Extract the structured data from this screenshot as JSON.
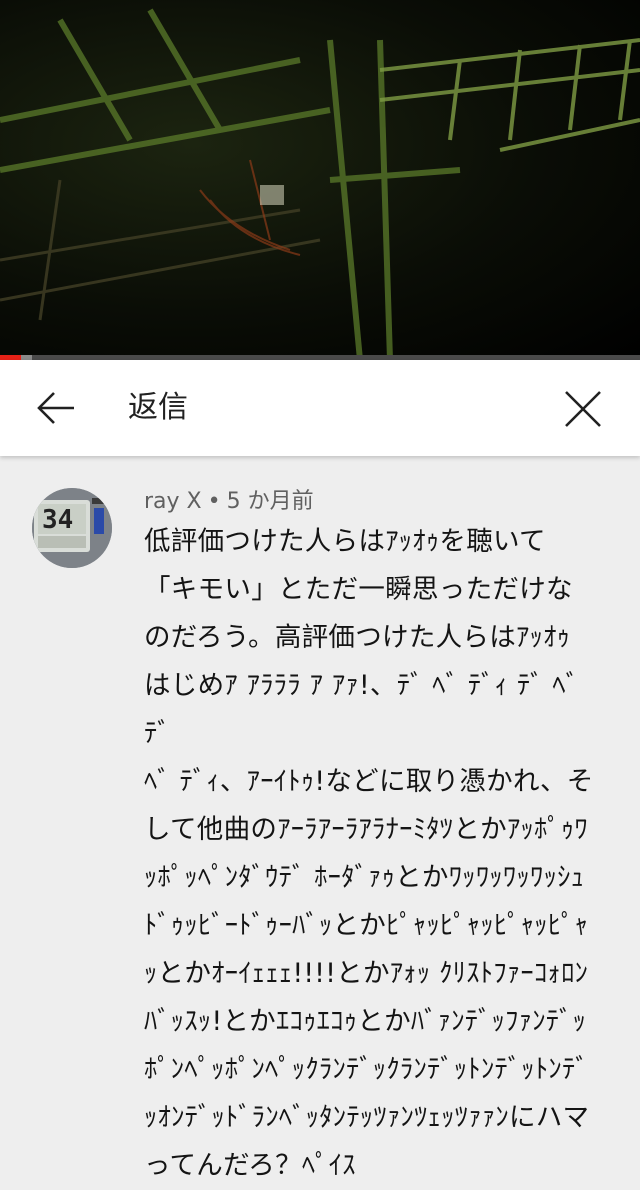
{
  "video": {
    "progress_fraction": 0.033,
    "buffer_fraction": 0.05
  },
  "header": {
    "title": "返信",
    "back_icon": "arrow-left-icon",
    "close_icon": "close-icon"
  },
  "comment": {
    "author": "ray X",
    "separator": "•",
    "time": "5 か月前",
    "avatar_clock_text": "34",
    "text": "低評価つけた人らはｱｯｵｩを聴いて\n「キモい」とただ一瞬思っただけな\nのだろう。高評価つけた人らはｱｯｵｩ\nはじめｱ ｱﾗﾗﾗ ｱ ｱｧ!、ﾃﾞ ﾍﾞ ﾃﾞｨ ﾃﾞ ﾍﾞ ﾃﾞ\nﾍﾞ ﾃﾞｨ、ｱｰｲﾄｩ!などに取り憑かれ、そ\nして他曲のｱｰﾗｱｰﾗｱﾗﾅｰﾐﾀﾂとかｱｯﾎﾟｩﾜ\nｯﾎﾟｯﾍﾟﾝﾀﾞｳﾃﾞ ﾎｰﾀﾞｧｩとかﾜｯﾜｯﾜｯﾜｯｼｭ\nﾄﾞｩｯﾋﾞｰﾄﾞｩｰﾊﾞｯとかﾋﾟｬｯﾋﾟｬｯﾋﾟｬｯﾋﾟｬ\nｯとかｵｰｲｪｪｪ!!!!とかｱｫｯ ｸﾘｽﾄﾌｧｰｺｫﾛﾝ\nﾊﾞｯｽｯ!とかｴｺｩｴｺｩとかﾊﾞｧﾝﾃﾞｯﾌｧﾝﾃﾞｯ\nﾎﾟﾝﾍﾟｯﾎﾟﾝﾍﾟｯｸﾗﾝﾃﾞｯｸﾗﾝﾃﾞｯﾄﾝﾃﾞｯﾄﾝﾃﾞ\nｯｵﾝﾃﾞｯﾄﾞﾗﾝﾍﾞｯﾀﾝﾃｯﾂｧﾝﾂｪｯﾂｧｧﾝにハマ\nってんだろ？ﾍﾟｲｽ"
  },
  "colors": {
    "progress": "#e62117",
    "header_bg": "#ffffff",
    "content_bg": "#eeeeee",
    "meta_text": "#606060"
  }
}
